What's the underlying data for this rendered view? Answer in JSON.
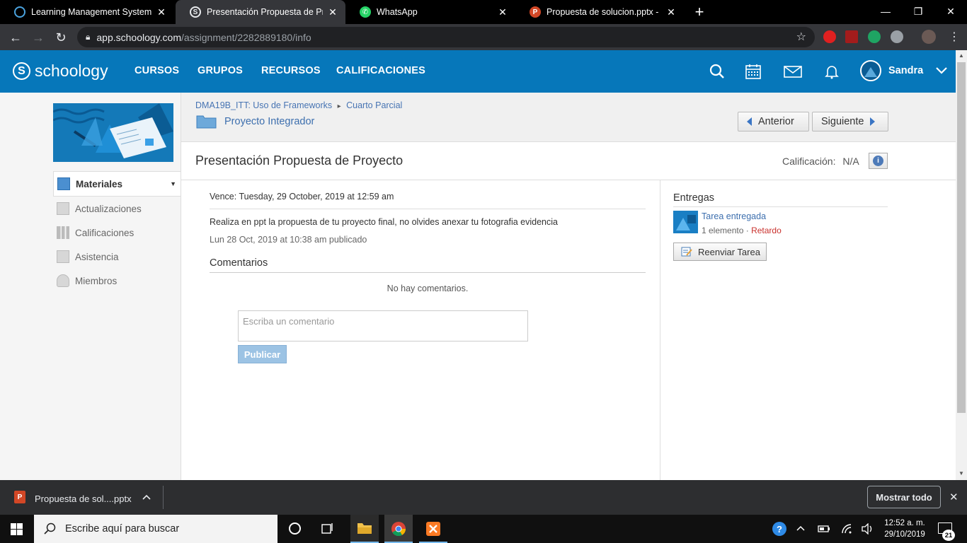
{
  "browser": {
    "tabs": [
      {
        "title": "Learning Management System | L",
        "active": false
      },
      {
        "title": "Presentación Propuesta de Proye",
        "active": true
      },
      {
        "title": "WhatsApp",
        "active": false
      },
      {
        "title": "Propuesta de solucion.pptx - Mic",
        "active": false
      }
    ],
    "url_host": "app.schoology.com",
    "url_path": "/assignment/2282889180/info",
    "new_tab_icon": "plus-icon"
  },
  "header": {
    "logo_text": "schoology",
    "logo_mark": "S",
    "nav": [
      "CURSOS",
      "GRUPOS",
      "RECURSOS",
      "CALIFICACIONES"
    ],
    "user_name": "Sandra",
    "brand_color": "#0677ba"
  },
  "sidebar": {
    "items": [
      {
        "label": "Materiales",
        "icon": "materials-icon",
        "active": true
      },
      {
        "label": "Actualizaciones",
        "icon": "updates-icon",
        "active": false
      },
      {
        "label": "Calificaciones",
        "icon": "grades-icon",
        "active": false
      },
      {
        "label": "Asistencia",
        "icon": "attendance-icon",
        "active": false
      },
      {
        "label": "Miembros",
        "icon": "members-icon",
        "active": false
      }
    ]
  },
  "breadcrumb": {
    "course": "DMA19B_ITT: Uso de Frameworks",
    "separator": "▸",
    "section": "Cuarto Parcial",
    "folder": "Proyecto Integrador"
  },
  "pager": {
    "prev": "Anterior",
    "next": "Siguiente"
  },
  "assignment": {
    "title": "Presentación Propuesta de Proyecto",
    "grade_label": "Calificación:",
    "grade_value": "N/A",
    "due": "Vence: Tuesday, 29 October, 2019 at 12:59 am",
    "description": "Realiza en ppt la propuesta de tu proyecto final, no olvides anexar tu fotografia evidencia",
    "posted": "Lun 28 Oct, 2019 at 10:38 am publicado"
  },
  "comments": {
    "heading": "Comentarios",
    "empty": "No hay comentarios.",
    "placeholder": "Escriba un comentario",
    "submit": "Publicar"
  },
  "submissions": {
    "heading": "Entregas",
    "status": "Tarea entregada",
    "count": "1 elemento",
    "dot": "·",
    "late": "Retardo",
    "resubmit": "Reenviar Tarea"
  },
  "downloads": {
    "file": "Propuesta de sol....pptx",
    "show_all": "Mostrar todo"
  },
  "taskbar": {
    "search_placeholder": "Escribe aquí para buscar",
    "time": "12:52 a. m.",
    "date": "29/10/2019",
    "notifications": "21"
  }
}
